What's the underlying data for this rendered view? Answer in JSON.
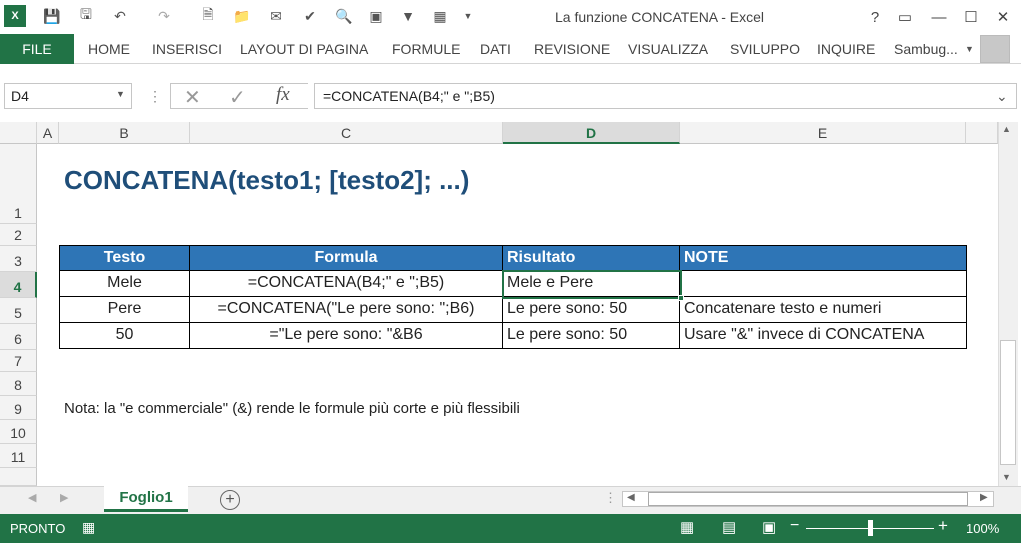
{
  "window": {
    "title": "La funzione CONCATENA - Excel"
  },
  "ribbon": {
    "file": "FILE",
    "tabs": [
      "HOME",
      "INSERISCI",
      "LAYOUT DI PAGINA",
      "FORMULE",
      "DATI",
      "REVISIONE",
      "VISUALIZZA",
      "SVILUPPO",
      "INQUIRE"
    ],
    "user": "Sambug..."
  },
  "formula_bar": {
    "name_box": "D4",
    "formula": "=CONCATENA(B4;\" e \";B5)",
    "fx": "fx"
  },
  "columns": [
    "A",
    "B",
    "C",
    "D",
    "E"
  ],
  "rows": [
    "1",
    "2",
    "3",
    "4",
    "5",
    "6",
    "7",
    "8",
    "9",
    "10",
    "11"
  ],
  "sheet": {
    "heading": "CONCATENA(testo1; [testo2]; ...)",
    "table_headers": [
      "Testo",
      "Formula",
      "Risultato",
      "NOTE"
    ],
    "table_rows": [
      [
        "Mele",
        "=CONCATENA(B4;\" e \";B5)",
        "Mele e Pere",
        ""
      ],
      [
        "Pere",
        "=CONCATENA(\"Le pere sono: \";B6)",
        "Le pere sono: 50",
        "Concatenare testo e numeri"
      ],
      [
        "50",
        "=\"Le pere sono: \"&B6",
        "Le pere sono: 50",
        "Usare \"&\" invece di CONCATENA"
      ]
    ],
    "note": "Nota: la \"e commerciale\" (&) rende le formule più corte e più flessibili"
  },
  "sheet_tabs": {
    "active": "Foglio1"
  },
  "status": {
    "ready": "PRONTO",
    "zoom": "100%"
  },
  "colors": {
    "accent": "#217346",
    "table_header": "#2e75b6",
    "heading": "#1f4e79"
  }
}
